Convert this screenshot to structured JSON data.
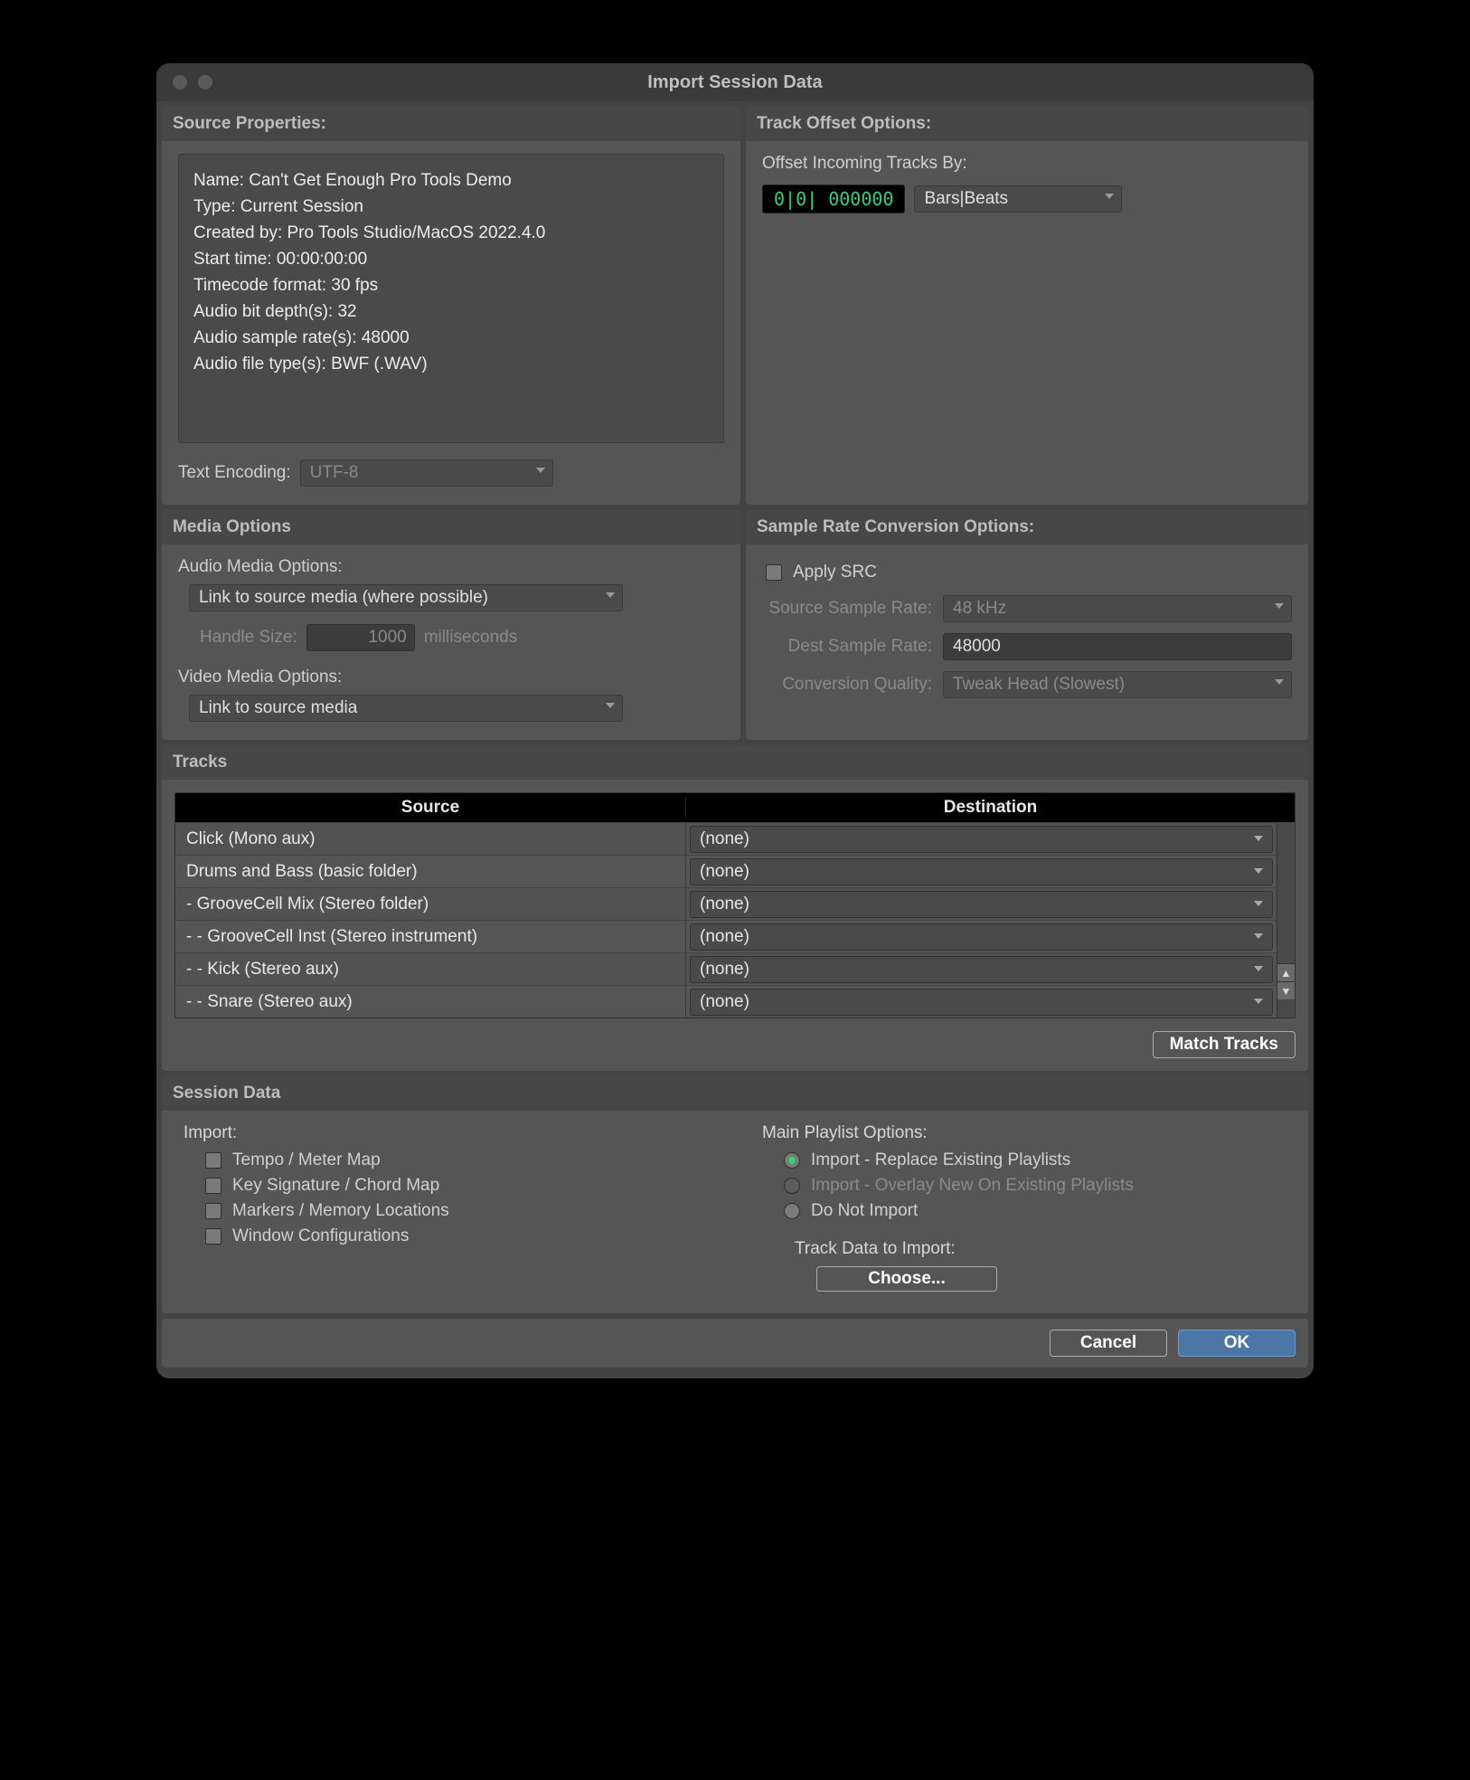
{
  "window": {
    "title": "Import Session Data"
  },
  "source_props": {
    "header": "Source Properties:",
    "lines": {
      "name": "Name: Can't Get Enough Pro Tools Demo",
      "type": "Type: Current Session",
      "created": "Created by: Pro Tools Studio/MacOS 2022.4.0",
      "start": "Start time: 00:00:00:00",
      "tc": "Timecode format: 30 fps",
      "bits": "Audio bit depth(s): 32",
      "rate": "Audio sample rate(s): 48000",
      "ftype": "Audio file type(s): BWF (.WAV)"
    },
    "encoding_label": "Text Encoding:",
    "encoding_value": "UTF-8"
  },
  "track_offset": {
    "header": "Track Offset Options:",
    "label": "Offset Incoming Tracks By:",
    "value": "0|0| 000000",
    "unit": "Bars|Beats"
  },
  "media_options": {
    "header": "Media Options",
    "audio_label": "Audio Media Options:",
    "audio_value": "Link to source media (where possible)",
    "handle_label": "Handle Size:",
    "handle_value": "1000",
    "handle_unit": "milliseconds",
    "video_label": "Video Media Options:",
    "video_value": "Link to source media"
  },
  "src_options": {
    "header": "Sample Rate Conversion Options:",
    "apply_label": "Apply SRC",
    "source_label": "Source Sample Rate:",
    "source_value": "48 kHz",
    "dest_label": "Dest Sample Rate:",
    "dest_value": "48000",
    "quality_label": "Conversion Quality:",
    "quality_value": "Tweak Head (Slowest)"
  },
  "tracks": {
    "header": "Tracks",
    "col_source": "Source",
    "col_dest": "Destination",
    "rows": [
      {
        "src": "Click (Mono aux)",
        "dst": "(none)"
      },
      {
        "src": "Drums and Bass (basic folder)",
        "dst": "(none)"
      },
      {
        "src": "- GrooveCell Mix (Stereo folder)",
        "dst": "(none)"
      },
      {
        "src": "- - GrooveCell Inst (Stereo instrument)",
        "dst": "(none)"
      },
      {
        "src": "- - Kick (Stereo aux)",
        "dst": "(none)"
      },
      {
        "src": "- - Snare (Stereo aux)",
        "dst": "(none)"
      }
    ],
    "match_button": "Match Tracks"
  },
  "session_data": {
    "header": "Session Data",
    "import_label": "Import:",
    "import_items": {
      "tempo": "Tempo / Meter Map",
      "key": "Key Signature / Chord Map",
      "markers": "Markers / Memory Locations",
      "windows": "Window Configurations"
    },
    "playlist_label": "Main Playlist Options:",
    "playlist_options": {
      "replace": "Import - Replace Existing Playlists",
      "overlay": "Import - Overlay New On Existing Playlists",
      "donot": "Do Not Import"
    },
    "trackdata_label": "Track Data to Import:",
    "choose_button": "Choose..."
  },
  "footer": {
    "cancel": "Cancel",
    "ok": "OK"
  }
}
